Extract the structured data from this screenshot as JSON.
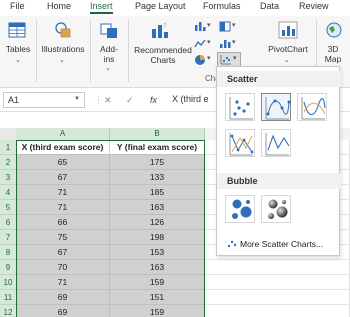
{
  "tabs": [
    "File",
    "Home",
    "Insert",
    "Page Layout",
    "Formulas",
    "Data",
    "Review"
  ],
  "active_tab": "Insert",
  "ribbon": {
    "tables": "Tables",
    "illustrations": "Illustrations",
    "addins_line1": "Add-",
    "addins_line2": "ins",
    "recommended_line1": "Recommended",
    "recommended_line2": "Charts",
    "charts_group": "Cha",
    "pivotchart": "PivotChart",
    "map_line1": "3D",
    "map_line2": "Map"
  },
  "formula_bar": {
    "name_box": "A1",
    "cancel_icon": "✕",
    "enter_icon": "✓",
    "fx": "fx",
    "content": "X (third e"
  },
  "sheet": {
    "columns": [
      "A",
      "B"
    ],
    "headers": [
      "X (third exam score)",
      "Y (final exam score)"
    ],
    "rows": [
      [
        "65",
        "175"
      ],
      [
        "67",
        "133"
      ],
      [
        "71",
        "185"
      ],
      [
        "71",
        "163"
      ],
      [
        "66",
        "126"
      ],
      [
        "75",
        "198"
      ],
      [
        "67",
        "153"
      ],
      [
        "70",
        "163"
      ],
      [
        "71",
        "159"
      ],
      [
        "69",
        "151"
      ],
      [
        "69",
        "159"
      ]
    ],
    "row_numbers": [
      "1",
      "2",
      "3",
      "4",
      "5",
      "6",
      "7",
      "8",
      "9",
      "10",
      "11",
      "12"
    ]
  },
  "dropdown": {
    "scatter_title": "Scatter",
    "bubble_title": "Bubble",
    "more_label": "More Scatter Charts...",
    "scatter_options": [
      "scatter",
      "scatter-smooth-lines-markers",
      "scatter-smooth-lines",
      "scatter-straight-lines-markers",
      "scatter-straight-lines"
    ],
    "bubble_options": [
      "bubble",
      "bubble-3d"
    ]
  },
  "colors": {
    "accent": "#1e6b3a",
    "selection_fill": "#d0d0d0",
    "header_tint": "#d6e8d8"
  }
}
